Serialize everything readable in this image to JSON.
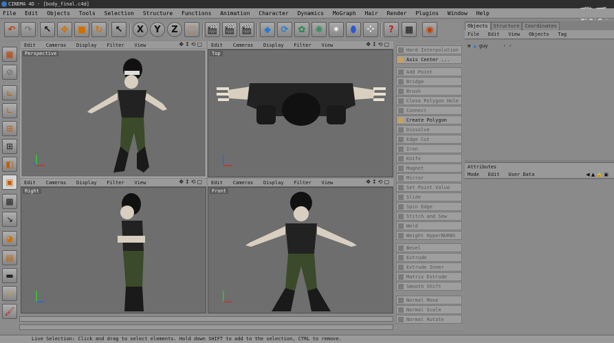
{
  "window": {
    "title": "CINEMA 4D - [body_final.c4d]",
    "watermark": "我乐"
  },
  "menu": [
    "File",
    "Edit",
    "Objects",
    "Tools",
    "Selection",
    "Structure",
    "Functions",
    "Animation",
    "Character",
    "Dynamics",
    "MoGraph",
    "Hair",
    "Render",
    "Plugins",
    "Window",
    "Help"
  ],
  "viewport_menu": [
    "Edit",
    "Cameras",
    "Display",
    "Filter",
    "View"
  ],
  "viewports": {
    "perspective": "Perspective",
    "top": "Top",
    "right": "Right",
    "front": "Front"
  },
  "toolbar": {
    "undo": "undo-icon",
    "redo": "redo-icon",
    "x_axis": "X",
    "y_axis": "Y",
    "z_axis": "Z"
  },
  "commands": [
    {
      "label": "Hard Interpolation",
      "enabled": false
    },
    {
      "label": "Axis Center ...",
      "enabled": true
    },
    {
      "label": "Add Point",
      "enabled": false
    },
    {
      "label": "Bridge",
      "enabled": false
    },
    {
      "label": "Brush",
      "enabled": false
    },
    {
      "label": "Close Polygon Hole",
      "enabled": false
    },
    {
      "label": "Connect",
      "enabled": false
    },
    {
      "label": "Create Polygon",
      "enabled": true
    },
    {
      "label": "Dissolve",
      "enabled": false
    },
    {
      "label": "Edge Cut",
      "enabled": false
    },
    {
      "label": "Iron",
      "enabled": false
    },
    {
      "label": "Knife",
      "enabled": false
    },
    {
      "label": "Magnet",
      "enabled": false
    },
    {
      "label": "Mirror",
      "enabled": false
    },
    {
      "label": "Set Point Value",
      "enabled": false
    },
    {
      "label": "Slide",
      "enabled": false
    },
    {
      "label": "Spin Edge",
      "enabled": false
    },
    {
      "label": "Stitch and Sew",
      "enabled": false
    },
    {
      "label": "Weld",
      "enabled": false
    },
    {
      "label": "Weight HyperNURBS",
      "enabled": false
    },
    {
      "label": "Bevel",
      "enabled": false
    },
    {
      "label": "Extrude",
      "enabled": false
    },
    {
      "label": "Extrude Inner",
      "enabled": false
    },
    {
      "label": "Matrix Extrude",
      "enabled": false
    },
    {
      "label": "Smooth Shift",
      "enabled": false
    },
    {
      "label": "Normal Move",
      "enabled": false
    },
    {
      "label": "Normal Scale",
      "enabled": false
    },
    {
      "label": "Normal Rotate",
      "enabled": false
    }
  ],
  "right_panel": {
    "tabs": [
      "Objects",
      "Structure",
      "Coordinates"
    ],
    "menu": [
      "File",
      "Edit",
      "View",
      "Objects",
      "Tag"
    ],
    "object_name": "guy",
    "attributes_title": "Attributes",
    "attributes_menu": [
      "Mode",
      "Edit",
      "User Data"
    ]
  },
  "status": "Live Selection: Click and drag to select elements. Hold down SHIFT to add to the selection, CTRL to remove."
}
